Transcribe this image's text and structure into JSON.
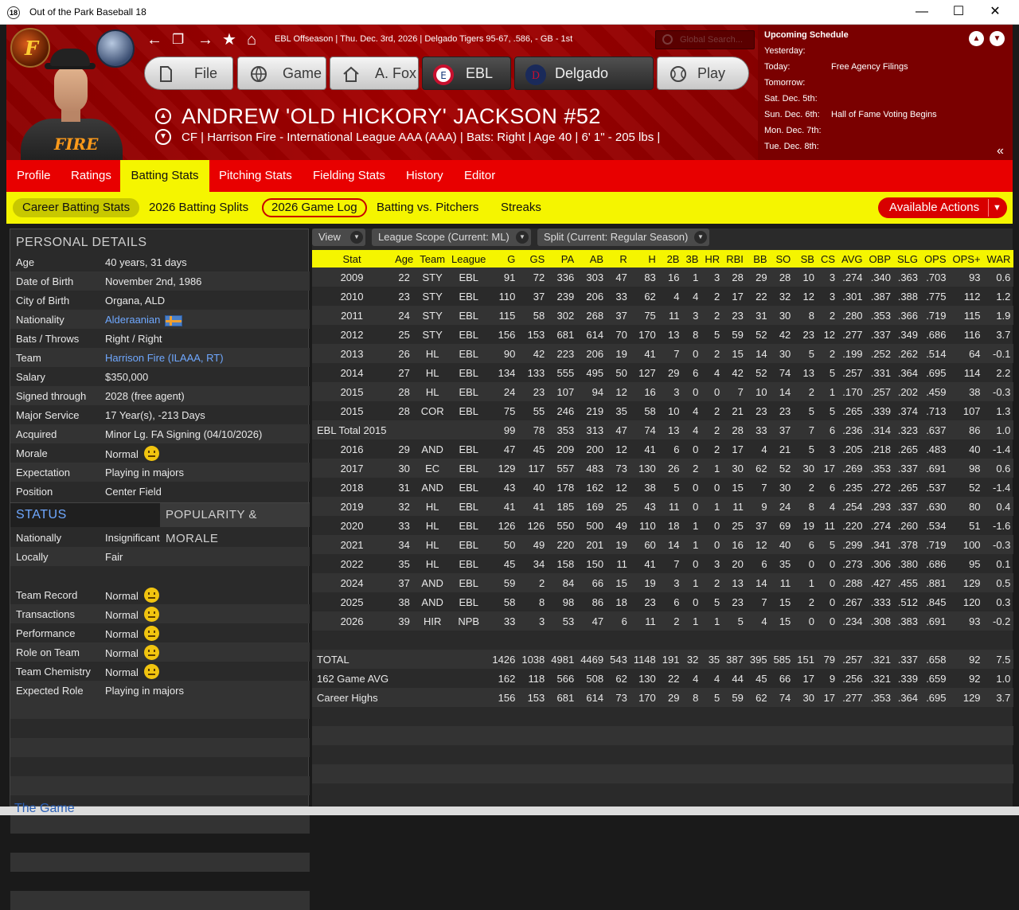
{
  "window": {
    "title": "Out of the Park Baseball 18",
    "icon_label": "18"
  },
  "header": {
    "info_line": "EBL Offseason  |  Thu. Dec. 3rd, 2026  |  Delgado Tigers   95-67, .586, - GB - 1st",
    "search_placeholder": "Global Search...",
    "menu": [
      "File",
      "Game",
      "A. Fox",
      "EBL",
      "Delgado",
      "Play"
    ],
    "player_name": "ANDREW 'OLD HICKORY' JACKSON   #52",
    "player_info": "CF | Harrison Fire - International League AAA (AAA)  |  Bats: Right  |  Age 40  |  6' 1\" - 205 lbs  |"
  },
  "schedule": {
    "title": "Upcoming Schedule",
    "rows": [
      {
        "day": "Yesterday:",
        "event": ""
      },
      {
        "day": "Today:",
        "event": "Free Agency Filings"
      },
      {
        "day": "Tomorrow:",
        "event": ""
      },
      {
        "day": "Sat. Dec. 5th:",
        "event": ""
      },
      {
        "day": "Sun. Dec. 6th:",
        "event": "Hall of Fame Voting Begins"
      },
      {
        "day": "Mon. Dec. 7th:",
        "event": ""
      },
      {
        "day": "Tue. Dec. 8th:",
        "event": ""
      }
    ]
  },
  "tabs": [
    "Profile",
    "Ratings",
    "Batting Stats",
    "Pitching Stats",
    "Fielding Stats",
    "History",
    "Editor"
  ],
  "subtabs": [
    "Career Batting Stats",
    "2026 Batting Splits",
    "2026 Game Log",
    "Batting vs. Pitchers",
    "Streaks"
  ],
  "available_actions": "Available Actions",
  "personal": {
    "title": "PERSONAL DETAILS",
    "rows": [
      {
        "k": "Age",
        "v": "40 years, 31 days"
      },
      {
        "k": "Date of Birth",
        "v": "November 2nd, 1986"
      },
      {
        "k": "City of Birth",
        "v": "Organa, ALD"
      },
      {
        "k": "Nationality",
        "v": "Alderaanian"
      },
      {
        "k": "Bats / Throws",
        "v": "Right / Right"
      },
      {
        "k": "Team",
        "v": "Harrison Fire (ILAAA, RT)"
      },
      {
        "k": "Salary",
        "v": "$350,000"
      },
      {
        "k": "Signed through",
        "v": "2028 (free agent)"
      },
      {
        "k": "Major Service",
        "v": "17 Year(s), -213 Days"
      },
      {
        "k": "Acquired",
        "v": "Minor Lg. FA Signing (04/10/2026)"
      },
      {
        "k": "Morale",
        "v": "Normal"
      },
      {
        "k": "Expectation",
        "v": "Playing in majors"
      },
      {
        "k": "Position",
        "v": "Center Field"
      }
    ]
  },
  "status": {
    "title": "STATUS",
    "tab2": "POPULARITY & MORALE",
    "rows": [
      {
        "k": "Nationally",
        "v": "Insignificant"
      },
      {
        "k": "Locally",
        "v": "Fair"
      }
    ],
    "morale_rows": [
      {
        "k": "Team Record",
        "v": "Normal"
      },
      {
        "k": "Transactions",
        "v": "Normal"
      },
      {
        "k": "Performance",
        "v": "Normal"
      },
      {
        "k": "Role on Team",
        "v": "Normal"
      },
      {
        "k": "Team Chemistry",
        "v": "Normal"
      },
      {
        "k": "Expected Role",
        "v": "Playing in majors"
      }
    ]
  },
  "filters": {
    "view": "View",
    "scope": "League Scope  (Current: ML)",
    "split": "Split  (Current: Regular Season)"
  },
  "stats": {
    "columns": [
      "Stat",
      "Age",
      "Team",
      "League",
      "G",
      "GS",
      "PA",
      "AB",
      "R",
      "H",
      "2B",
      "3B",
      "HR",
      "RBI",
      "BB",
      "SO",
      "SB",
      "CS",
      "AVG",
      "OBP",
      "SLG",
      "OPS",
      "OPS+",
      "WAR"
    ],
    "rows": [
      [
        "2009",
        "22",
        "STY",
        "EBL",
        "91",
        "72",
        "336",
        "303",
        "47",
        "83",
        "16",
        "1",
        "3",
        "28",
        "29",
        "28",
        "10",
        "3",
        ".274",
        ".340",
        ".363",
        ".703",
        "93",
        "0.6"
      ],
      [
        "2010",
        "23",
        "STY",
        "EBL",
        "110",
        "37",
        "239",
        "206",
        "33",
        "62",
        "4",
        "4",
        "2",
        "17",
        "22",
        "32",
        "12",
        "3",
        ".301",
        ".387",
        ".388",
        ".775",
        "112",
        "1.2"
      ],
      [
        "2011",
        "24",
        "STY",
        "EBL",
        "115",
        "58",
        "302",
        "268",
        "37",
        "75",
        "11",
        "3",
        "2",
        "23",
        "31",
        "30",
        "8",
        "2",
        ".280",
        ".353",
        ".366",
        ".719",
        "115",
        "1.9"
      ],
      [
        "2012",
        "25",
        "STY",
        "EBL",
        "156",
        "153",
        "681",
        "614",
        "70",
        "170",
        "13",
        "8",
        "5",
        "59",
        "52",
        "42",
        "23",
        "12",
        ".277",
        ".337",
        ".349",
        ".686",
        "116",
        "3.7"
      ],
      [
        "2013",
        "26",
        "HL",
        "EBL",
        "90",
        "42",
        "223",
        "206",
        "19",
        "41",
        "7",
        "0",
        "2",
        "15",
        "14",
        "30",
        "5",
        "2",
        ".199",
        ".252",
        ".262",
        ".514",
        "64",
        "-0.1"
      ],
      [
        "2014",
        "27",
        "HL",
        "EBL",
        "134",
        "133",
        "555",
        "495",
        "50",
        "127",
        "29",
        "6",
        "4",
        "42",
        "52",
        "74",
        "13",
        "5",
        ".257",
        ".331",
        ".364",
        ".695",
        "114",
        "2.2"
      ],
      [
        "2015",
        "28",
        "HL",
        "EBL",
        "24",
        "23",
        "107",
        "94",
        "12",
        "16",
        "3",
        "0",
        "0",
        "7",
        "10",
        "14",
        "2",
        "1",
        ".170",
        ".257",
        ".202",
        ".459",
        "38",
        "-0.3"
      ],
      [
        "2015",
        "28",
        "COR",
        "EBL",
        "75",
        "55",
        "246",
        "219",
        "35",
        "58",
        "10",
        "4",
        "2",
        "21",
        "23",
        "23",
        "5",
        "5",
        ".265",
        ".339",
        ".374",
        ".713",
        "107",
        "1.3"
      ],
      [
        "EBL Total 2015",
        "",
        "",
        "",
        "99",
        "78",
        "353",
        "313",
        "47",
        "74",
        "13",
        "4",
        "2",
        "28",
        "33",
        "37",
        "7",
        "6",
        ".236",
        ".314",
        ".323",
        ".637",
        "86",
        "1.0"
      ],
      [
        "2016",
        "29",
        "AND",
        "EBL",
        "47",
        "45",
        "209",
        "200",
        "12",
        "41",
        "6",
        "0",
        "2",
        "17",
        "4",
        "21",
        "5",
        "3",
        ".205",
        ".218",
        ".265",
        ".483",
        "40",
        "-1.4"
      ],
      [
        "2017",
        "30",
        "EC",
        "EBL",
        "129",
        "117",
        "557",
        "483",
        "73",
        "130",
        "26",
        "2",
        "1",
        "30",
        "62",
        "52",
        "30",
        "17",
        ".269",
        ".353",
        ".337",
        ".691",
        "98",
        "0.6"
      ],
      [
        "2018",
        "31",
        "AND",
        "EBL",
        "43",
        "40",
        "178",
        "162",
        "12",
        "38",
        "5",
        "0",
        "0",
        "15",
        "7",
        "30",
        "2",
        "6",
        ".235",
        ".272",
        ".265",
        ".537",
        "52",
        "-1.4"
      ],
      [
        "2019",
        "32",
        "HL",
        "EBL",
        "41",
        "41",
        "185",
        "169",
        "25",
        "43",
        "11",
        "0",
        "1",
        "11",
        "9",
        "24",
        "8",
        "4",
        ".254",
        ".293",
        ".337",
        ".630",
        "80",
        "0.4"
      ],
      [
        "2020",
        "33",
        "HL",
        "EBL",
        "126",
        "126",
        "550",
        "500",
        "49",
        "110",
        "18",
        "1",
        "0",
        "25",
        "37",
        "69",
        "19",
        "11",
        ".220",
        ".274",
        ".260",
        ".534",
        "51",
        "-1.6"
      ],
      [
        "2021",
        "34",
        "HL",
        "EBL",
        "50",
        "49",
        "220",
        "201",
        "19",
        "60",
        "14",
        "1",
        "0",
        "16",
        "12",
        "40",
        "6",
        "5",
        ".299",
        ".341",
        ".378",
        ".719",
        "100",
        "-0.3"
      ],
      [
        "2022",
        "35",
        "HL",
        "EBL",
        "45",
        "34",
        "158",
        "150",
        "11",
        "41",
        "7",
        "0",
        "3",
        "20",
        "6",
        "35",
        "0",
        "0",
        ".273",
        ".306",
        ".380",
        ".686",
        "95",
        "0.1"
      ],
      [
        "2024",
        "37",
        "AND",
        "EBL",
        "59",
        "2",
        "84",
        "66",
        "15",
        "19",
        "3",
        "1",
        "2",
        "13",
        "14",
        "11",
        "1",
        "0",
        ".288",
        ".427",
        ".455",
        ".881",
        "129",
        "0.5"
      ],
      [
        "2025",
        "38",
        "AND",
        "EBL",
        "58",
        "8",
        "98",
        "86",
        "18",
        "23",
        "6",
        "0",
        "5",
        "23",
        "7",
        "15",
        "2",
        "0",
        ".267",
        ".333",
        ".512",
        ".845",
        "120",
        "0.3"
      ],
      [
        "2026",
        "39",
        "HIR",
        "NPB",
        "33",
        "3",
        "53",
        "47",
        "6",
        "11",
        "2",
        "1",
        "1",
        "5",
        "4",
        "15",
        "0",
        "0",
        ".234",
        ".308",
        ".383",
        ".691",
        "93",
        "-0.2"
      ]
    ],
    "totals": [
      [
        "TOTAL",
        "",
        "",
        "",
        "1426",
        "1038",
        "4981",
        "4469",
        "543",
        "1148",
        "191",
        "32",
        "35",
        "387",
        "395",
        "585",
        "151",
        "79",
        ".257",
        ".321",
        ".337",
        ".658",
        "92",
        "7.5"
      ],
      [
        "162 Game AVG",
        "",
        "",
        "",
        "162",
        "118",
        "566",
        "508",
        "62",
        "130",
        "22",
        "4",
        "4",
        "44",
        "45",
        "66",
        "17",
        "9",
        ".256",
        ".321",
        ".339",
        ".659",
        "92",
        "1.0"
      ],
      [
        "Career Highs",
        "",
        "",
        "",
        "156",
        "153",
        "681",
        "614",
        "73",
        "170",
        "29",
        "8",
        "5",
        "59",
        "62",
        "74",
        "30",
        "17",
        ".277",
        ".353",
        ".364",
        ".695",
        "129",
        "3.7"
      ]
    ]
  },
  "bottom_strip_text": "The Game"
}
